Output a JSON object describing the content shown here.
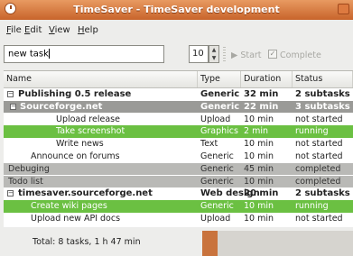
{
  "window": {
    "title": "TimeSaver - TimeSaver development",
    "title_button": ""
  },
  "menu": [
    {
      "label": "File",
      "mnemonic": "F",
      "rest": "ile"
    },
    {
      "label": "Edit",
      "mnemonic": "E",
      "rest": "dit"
    },
    {
      "label": "View",
      "mnemonic": "V",
      "rest": "iew"
    },
    {
      "label": "Help",
      "mnemonic": "H",
      "rest": "elp"
    }
  ],
  "toolbar": {
    "task_input_value": "new task",
    "minutes_value": "10",
    "start_label": "Start",
    "complete_label": "Complete",
    "complete_checked": true
  },
  "table": {
    "headers": [
      "Name",
      "Type",
      "Duration",
      "Status"
    ],
    "rows": [
      {
        "name": "Publishing 0.5 release",
        "type": "Generic",
        "duration": "32 min",
        "status": "2 subtasks",
        "style": "parent",
        "expander": "−"
      },
      {
        "name": "Sourceforge.net",
        "type": "Generic",
        "duration": "22 min",
        "status": "3 subtasks",
        "style": "group",
        "expander": "−"
      },
      {
        "name": "Upload release",
        "type": "Upload",
        "duration": "10 min",
        "status": "not started",
        "style": "plain"
      },
      {
        "name": "Take screenshot",
        "type": "Graphics",
        "duration": "2 min",
        "status": "running",
        "style": "running"
      },
      {
        "name": "Write news",
        "type": "Text",
        "duration": "10 min",
        "status": "not started",
        "style": "plain"
      },
      {
        "name": "Announce on forums",
        "type": "Generic",
        "duration": "10 min",
        "status": "not started",
        "style": "plain"
      },
      {
        "name": "Debuging",
        "type": "Generic",
        "duration": "45 min",
        "status": "completed",
        "style": "done"
      },
      {
        "name": "Todo list",
        "type": "Generic",
        "duration": "10 min",
        "status": "completed",
        "style": "done"
      },
      {
        "name": "timesaver.sourceforge.net",
        "type": "Web design",
        "duration": "20 min",
        "status": "2 subtasks",
        "style": "parent",
        "expander": "−"
      },
      {
        "name": "Create wiki pages",
        "type": "Generic",
        "duration": "10 min",
        "status": "running",
        "style": "running"
      },
      {
        "name": "Upload new API docs",
        "type": "Upload",
        "duration": "10 min",
        "status": "not started",
        "style": "plain"
      }
    ]
  },
  "status": {
    "summary": "Total: 8 tasks, 1 h 47 min",
    "progress_fraction": 0.1
  },
  "colors": {
    "titlebar": "#d4743a",
    "running": "#6bc042",
    "group": "#9a9a97",
    "completed": "#b9b9b6"
  }
}
